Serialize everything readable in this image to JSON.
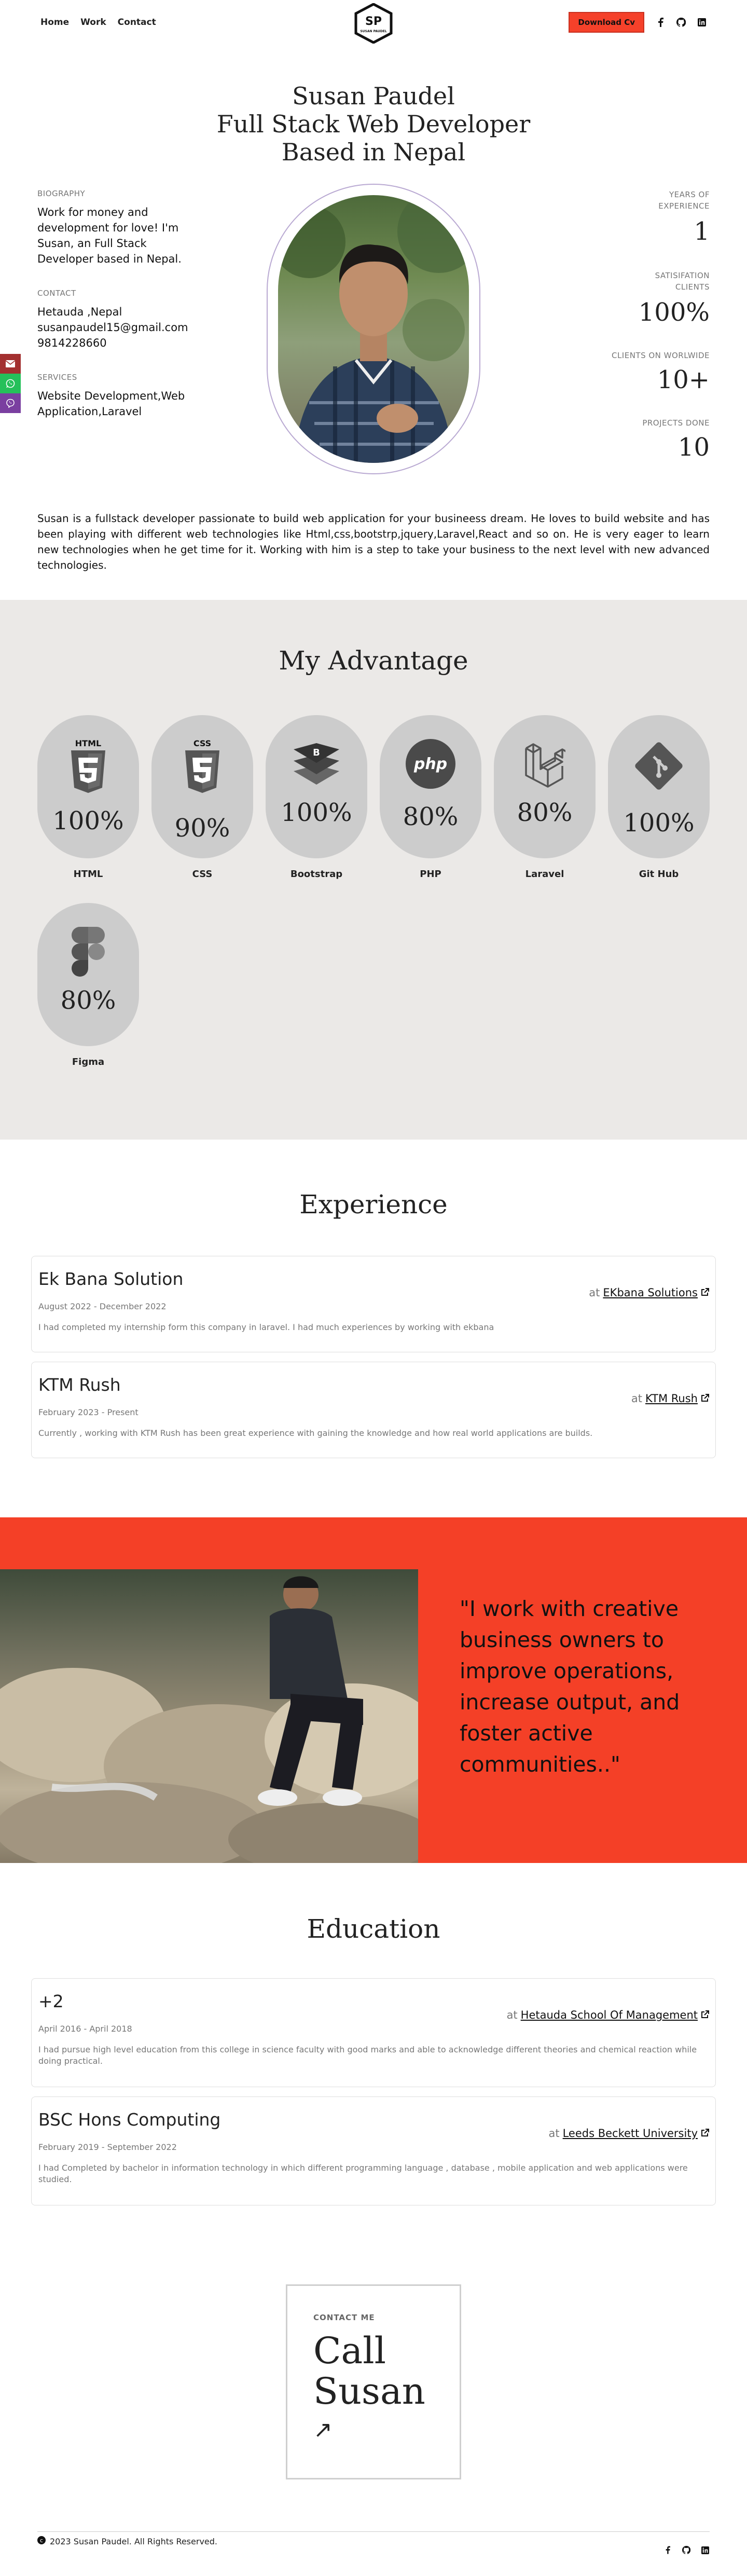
{
  "nav": {
    "links": [
      "Home",
      "Work",
      "Contact"
    ],
    "logo_initials": "SP",
    "logo_text": "SUSAN PAUDEL",
    "cv_button": "Download Cv",
    "social_icons": [
      "facebook-icon",
      "github-icon",
      "linkedin-icon"
    ]
  },
  "hero": {
    "title_lines": [
      "Susan Paudel",
      "Full Stack Web Developer",
      "Based in Nepal"
    ],
    "biography_label": "BIOGRAPHY",
    "biography_text": "Work for money and development for love! I'm Susan, an Full Stack Developer based in Nepal.",
    "contact_label": "CONTACT",
    "contact_address": "Hetauda ,Nepal",
    "contact_email": "susanpaudel15@gmail.com",
    "contact_phone": "9814228660",
    "services_label": "SERVICES",
    "services_text": "Website Development,Web Application,Laravel",
    "stats": [
      {
        "label": "YEARS OF EXPERIENCE",
        "value": "1"
      },
      {
        "label": "SATISIFATION CLIENTS",
        "value": "100%"
      },
      {
        "label": "CLIENTS ON WORLWIDE",
        "value": "10+"
      },
      {
        "label": "PROJECTS DONE",
        "value": "10"
      }
    ]
  },
  "about": "Susan is a fullstack developer passionate to build web application for your busineess dream. He loves to build website and has been playing with different web technologies like Html,css,bootstrp,jquery,Laravel,React and so on. He is very eager to learn new technologies when he get time for it. Working with him is a step to take your business to the next level with new advanced technologies.",
  "side_icons": [
    "mail-icon",
    "whatsapp-icon",
    "viber-icon"
  ],
  "advantage": {
    "title": "My Advantage",
    "skills": [
      {
        "name": "HTML",
        "percent": "100%",
        "icon": "html5-icon"
      },
      {
        "name": "CSS",
        "percent": "90%",
        "icon": "css3-icon"
      },
      {
        "name": "Bootstrap",
        "percent": "100%",
        "icon": "bootstrap-icon"
      },
      {
        "name": "PHP",
        "percent": "80%",
        "icon": "php-icon"
      },
      {
        "name": "Laravel",
        "percent": "80%",
        "icon": "laravel-icon"
      },
      {
        "name": "Git Hub",
        "percent": "100%",
        "icon": "git-icon"
      },
      {
        "name": "Figma",
        "percent": "80%",
        "icon": "figma-icon"
      }
    ]
  },
  "experience": {
    "title": "Experience",
    "items": [
      {
        "company": "Ek Bana Solution",
        "date": "August 2022 - December 2022",
        "desc": "I had completed my internship form this company in laravel. I had much experiences by working with ekbana",
        "at": "at",
        "link": "EKbana Solutions"
      },
      {
        "company": "KTM Rush",
        "date": "February 2023 - Present",
        "desc": "Currently , working with KTM Rush has been great experience with gaining the knowledge and how real world applications are builds.",
        "at": "at",
        "link": "KTM Rush"
      }
    ]
  },
  "quote": "\"I work with creative business owners to improve operations, increase output, and foster active communities..\"",
  "education": {
    "title": "Education",
    "items": [
      {
        "degree": "+2",
        "date": "April 2016 - April 2018",
        "desc": "I had pursue high level education from this college in science faculty with good marks and able to acknowledge different theories and chemical reaction while doing practical.",
        "at": "at",
        "link": "Hetauda School Of Management"
      },
      {
        "degree": "BSC Hons Computing",
        "date": "February 2019 - September 2022",
        "desc": "I had Completed by bachelor in information technology in which different programming language , database , mobile application and web applications were studied.",
        "at": "at",
        "link": "Leeds Beckett University"
      }
    ]
  },
  "contact": {
    "label": "CONTACT ME",
    "line1": "Call",
    "line2": "Susan",
    "arrow": "↗"
  },
  "footer": {
    "copyright": "2023 Susan Paudel. All Rights Reserved.",
    "icons": [
      "facebook-icon",
      "github-icon",
      "linkedin-icon"
    ]
  },
  "colors": {
    "accent": "#f44027",
    "section_bg": "#ebe9e7",
    "pill_bg": "#cccccc",
    "portrait_border": "#b9a9d2",
    "mail": "#a33030",
    "whatsapp": "#25c05a",
    "viber": "#7a3fa0"
  }
}
